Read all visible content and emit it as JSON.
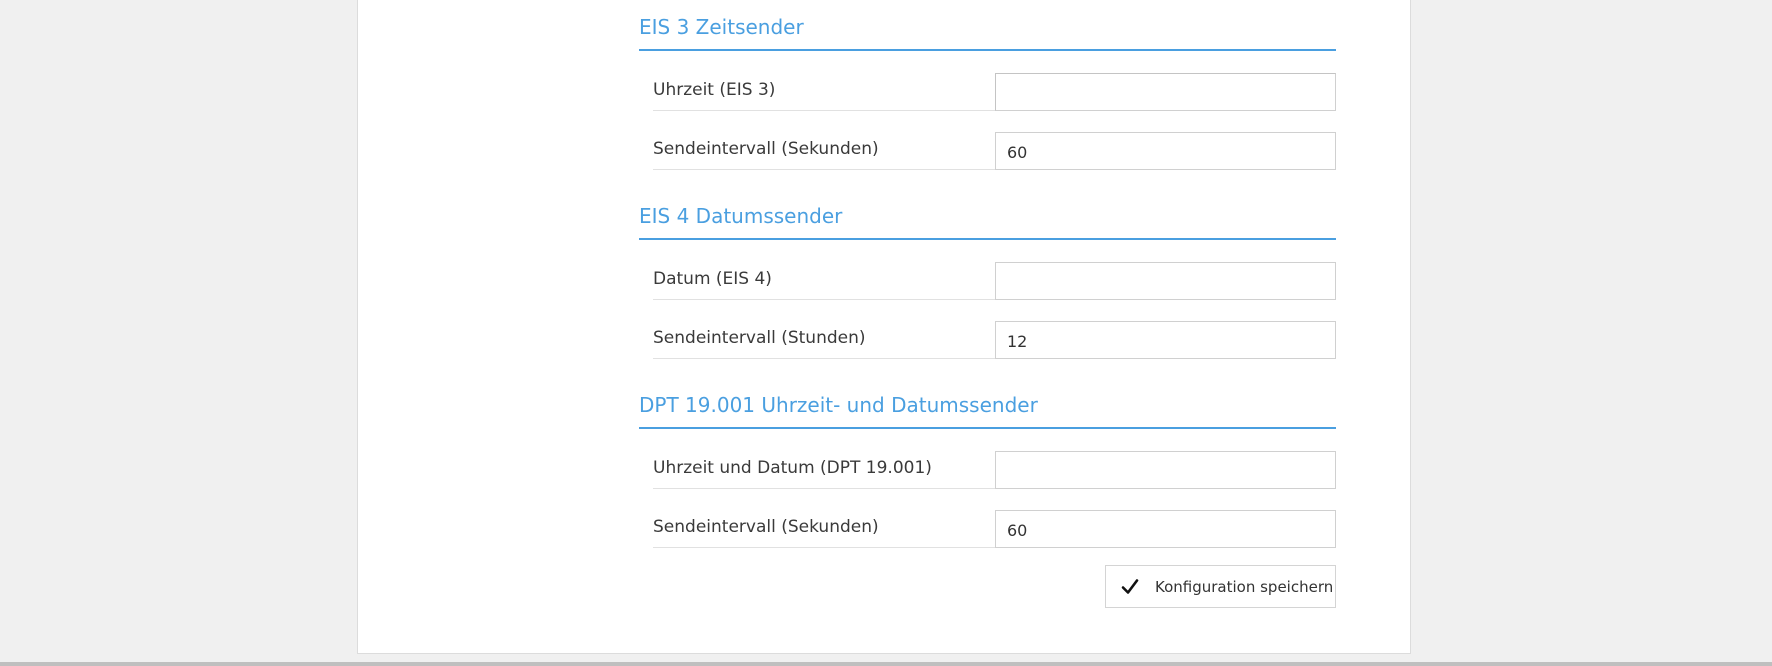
{
  "sections": [
    {
      "title": "EIS 3 Zeitsender",
      "rows": [
        {
          "label": "Uhrzeit (EIS 3)",
          "value": ""
        },
        {
          "label": "Sendeintervall (Sekunden)",
          "value": "60"
        }
      ]
    },
    {
      "title": "EIS 4 Datumssender",
      "rows": [
        {
          "label": "Datum (EIS 4)",
          "value": ""
        },
        {
          "label": "Sendeintervall (Stunden)",
          "value": "12"
        }
      ]
    },
    {
      "title": "DPT 19.001 Uhrzeit- und Datumssender",
      "rows": [
        {
          "label": "Uhrzeit und Datum (DPT 19.001)",
          "value": ""
        },
        {
          "label": "Sendeintervall (Sekunden)",
          "value": "60"
        }
      ]
    }
  ],
  "save_button": {
    "label": "Konfiguration speichern",
    "icon": "checkmark-icon"
  },
  "colors": {
    "accent": "#4a9fe0",
    "background": "#f0f0f0",
    "card": "#ffffff"
  }
}
